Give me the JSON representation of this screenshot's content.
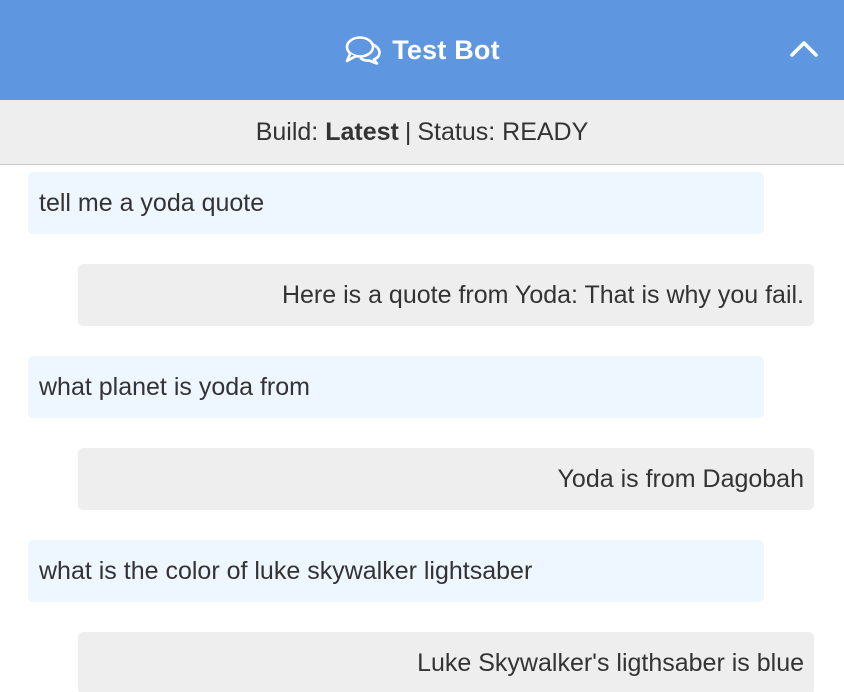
{
  "header": {
    "title": "Test Bot",
    "chat_icon": "chat-bubbles-icon",
    "collapse_icon": "chevron-up-icon",
    "background_color": "#5e97e0"
  },
  "status_bar": {
    "build_label": "Build:",
    "build_value": "Latest",
    "separator": "|",
    "status_label": "Status:",
    "status_value": "READY"
  },
  "messages": [
    {
      "role": "user",
      "text": "tell me a yoda quote"
    },
    {
      "role": "bot",
      "text": "Here is a quote from Yoda: That is why you fail."
    },
    {
      "role": "user",
      "text": "what planet is yoda from"
    },
    {
      "role": "bot",
      "text": "Yoda is from Dagobah"
    },
    {
      "role": "user",
      "text": "what is the color of luke skywalker lightsaber"
    },
    {
      "role": "bot",
      "text": "Luke Skywalker's ligthsaber is blue"
    }
  ]
}
